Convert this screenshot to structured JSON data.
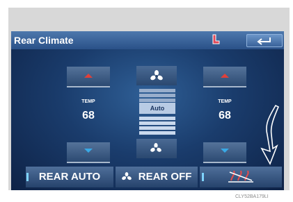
{
  "header": {
    "title": "Rear Climate"
  },
  "left_zone": {
    "temp_label": "TEMP",
    "temp_value": "68"
  },
  "right_zone": {
    "temp_label": "TEMP",
    "temp_value": "68"
  },
  "fan": {
    "auto_label": "Auto"
  },
  "bottom": {
    "rear_auto_label": "REAR AUTO",
    "rear_off_label": "REAR OFF"
  },
  "caption": "CLY52BA179LI",
  "colors": {
    "screen_blue": "#1a3c6c",
    "arrow_up_red": "#e0403a",
    "arrow_down_blue": "#39a9e6",
    "indicator_cyan": "#7fd3ff"
  },
  "icons": [
    "seat-icon",
    "back-icon",
    "fan-icon",
    "chevron-up-icon",
    "chevron-down-icon",
    "rear-defog-icon"
  ]
}
